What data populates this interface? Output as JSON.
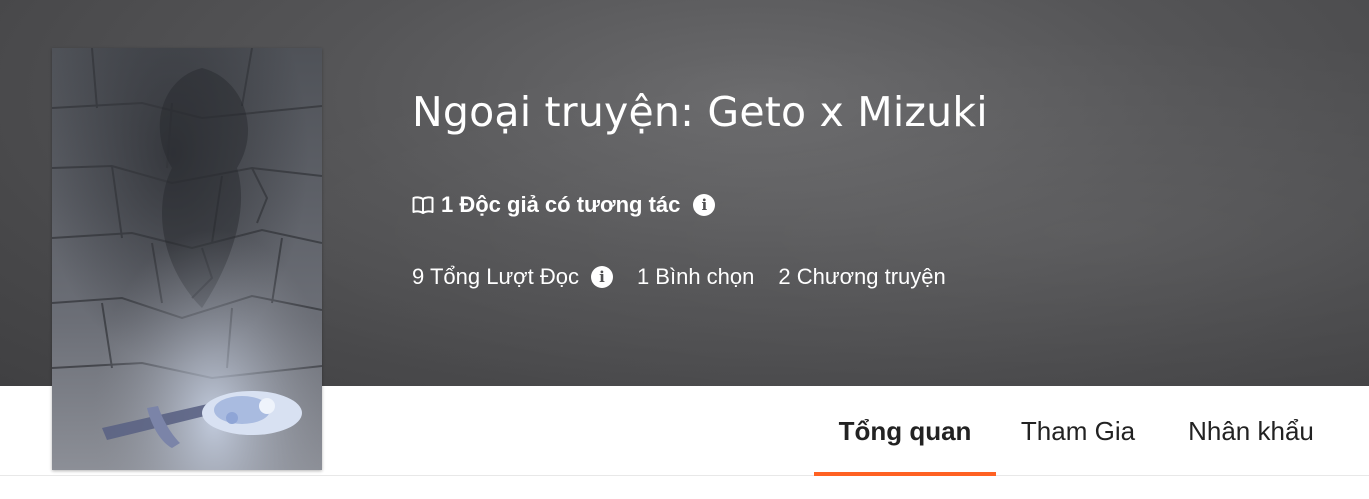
{
  "story": {
    "title": "Ngoại truyện: Geto x Mizuki",
    "engaged_readers": "1 Độc giả có tương tác",
    "stats": {
      "reads": "9 Tổng Lượt Đọc",
      "votes": "1 Bình chọn",
      "chapters": "2 Chương truyện"
    },
    "info_glyph": "i"
  },
  "tabs": [
    {
      "label": "Tổng quan",
      "active": true
    },
    {
      "label": "Tham Gia",
      "active": false
    },
    {
      "label": "Nhân khẩu",
      "active": false
    }
  ],
  "colors": {
    "hero_background": "#555557",
    "accent": "#ff6122",
    "text_light": "#ffffff",
    "text_dark": "#222222"
  },
  "icons": {
    "readers": "open-book-icon",
    "info": "info-circle-icon"
  }
}
